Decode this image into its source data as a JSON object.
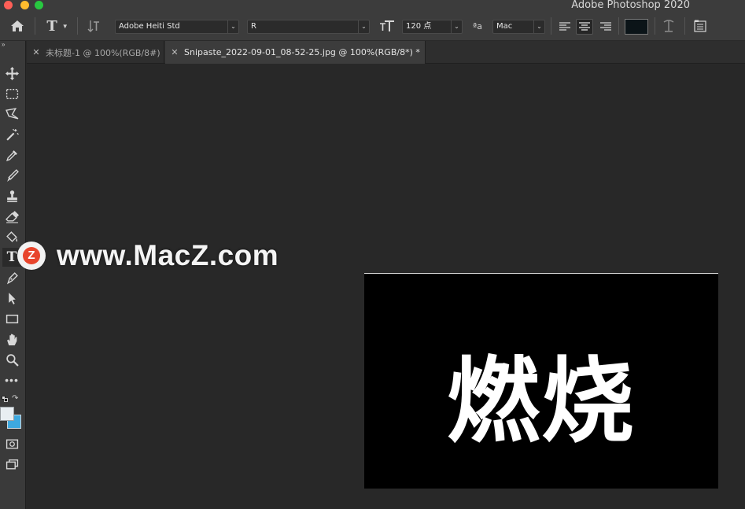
{
  "app": {
    "title": "Adobe Photoshop 2020"
  },
  "optionsBar": {
    "home_icon": "home-icon",
    "tool_icon": "horizontal-type-tool-icon",
    "orientation_icon": "text-orientation-icon",
    "font_family": "Adobe Heiti Std",
    "font_style": "R",
    "size_icon": "font-size-icon",
    "font_size": "120 点",
    "aa_icon": "anti-alias-icon",
    "anti_alias": "Mac",
    "align": [
      "left",
      "center",
      "right"
    ],
    "align_active": "center",
    "text_color": "#0b1418",
    "warp_icon": "warp-text-icon",
    "panels_icon": "character-paragraph-panels-icon"
  },
  "tabs": [
    {
      "title": "未标题-1 @ 100%(RGB/8#)",
      "active": false
    },
    {
      "title": "Snipaste_2022-09-01_08-52-25.jpg @ 100%(RGB/8*) *",
      "active": true
    }
  ],
  "toolbar": {
    "collapse": "»",
    "tools": [
      "move-tool",
      "marquee-tool",
      "lasso-tool",
      "magic-wand-tool",
      "eyedropper-tool",
      "brush-tool",
      "clone-stamp-tool",
      "eraser-tool",
      "paint-bucket-tool",
      "type-tool",
      "pen-tool",
      "path-selection-tool",
      "rectangle-tool",
      "hand-tool",
      "zoom-tool",
      "more-tools",
      "default-colors",
      "swap-colors",
      "foreground-color",
      "background-color",
      "quick-mask",
      "screen-mode"
    ],
    "active_tool": "type-tool",
    "foreground_color": "#e8eef2",
    "background_color": "#3ea9e0"
  },
  "canvas": {
    "text": "燃烧"
  },
  "watermark": {
    "logo_letter": "Z",
    "text": "www.MacZ.com"
  }
}
